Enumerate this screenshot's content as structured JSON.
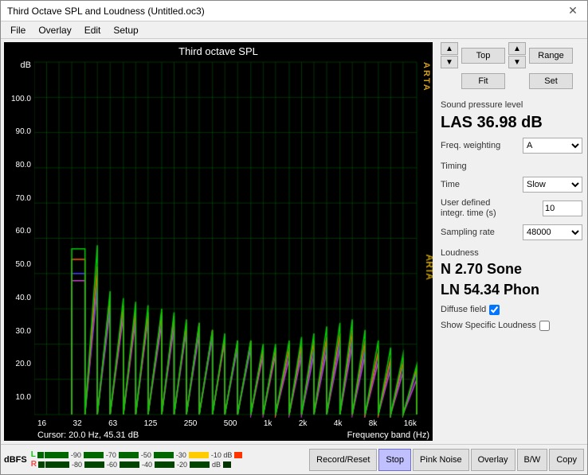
{
  "window": {
    "title": "Third Octave SPL and Loudness (Untitled.oc3)",
    "close_label": "✕"
  },
  "menu": {
    "items": [
      "File",
      "Overlay",
      "Edit",
      "Setup"
    ]
  },
  "chart": {
    "title": "Third octave SPL",
    "y_axis": [
      "100.0",
      "90.0",
      "80.0",
      "70.0",
      "60.0",
      "50.0",
      "40.0",
      "30.0",
      "20.0",
      "10.0"
    ],
    "y_label": "dB",
    "x_labels": [
      "16",
      "32",
      "63",
      "125",
      "250",
      "500",
      "1k",
      "2k",
      "4k",
      "8k",
      "16k"
    ],
    "x_axis_label": "Frequency band (Hz)",
    "cursor_info": "Cursor:  20.0 Hz, 45.31 dB",
    "right_label": "A\nR\nT\nA"
  },
  "right_panel": {
    "nav": {
      "top_label": "Top",
      "fit_label": "Fit",
      "range_label": "Range",
      "set_label": "Set"
    },
    "spl": {
      "section": "Sound pressure level",
      "value": "LAS 36.98 dB"
    },
    "freq_weighting": {
      "label": "Freq. weighting",
      "value": "A"
    },
    "timing": {
      "section": "Timing",
      "time_label": "Time",
      "time_value": "Slow",
      "user_defined_label": "User defined integr. time (s)",
      "user_defined_value": "10",
      "sampling_label": "Sampling rate",
      "sampling_value": "48000"
    },
    "loudness": {
      "section": "Loudness",
      "n_value": "N 2.70 Sone",
      "ln_value": "LN 54.34 Phon",
      "diffuse_label": "Diffuse field",
      "show_specific_label": "Show Specific Loudness"
    }
  },
  "bottom_bar": {
    "dbfs_label": "dBFS",
    "l_label": "L",
    "r_label": "R",
    "level_ticks_l": [
      "-90",
      "-70",
      "-50",
      "-30",
      "-10 dB"
    ],
    "level_ticks_r": [
      "-80",
      "-60",
      "-40",
      "-20",
      "dB"
    ],
    "buttons": [
      "Record/Reset",
      "Stop",
      "Pink Noise",
      "Overlay",
      "B/W",
      "Copy"
    ]
  }
}
